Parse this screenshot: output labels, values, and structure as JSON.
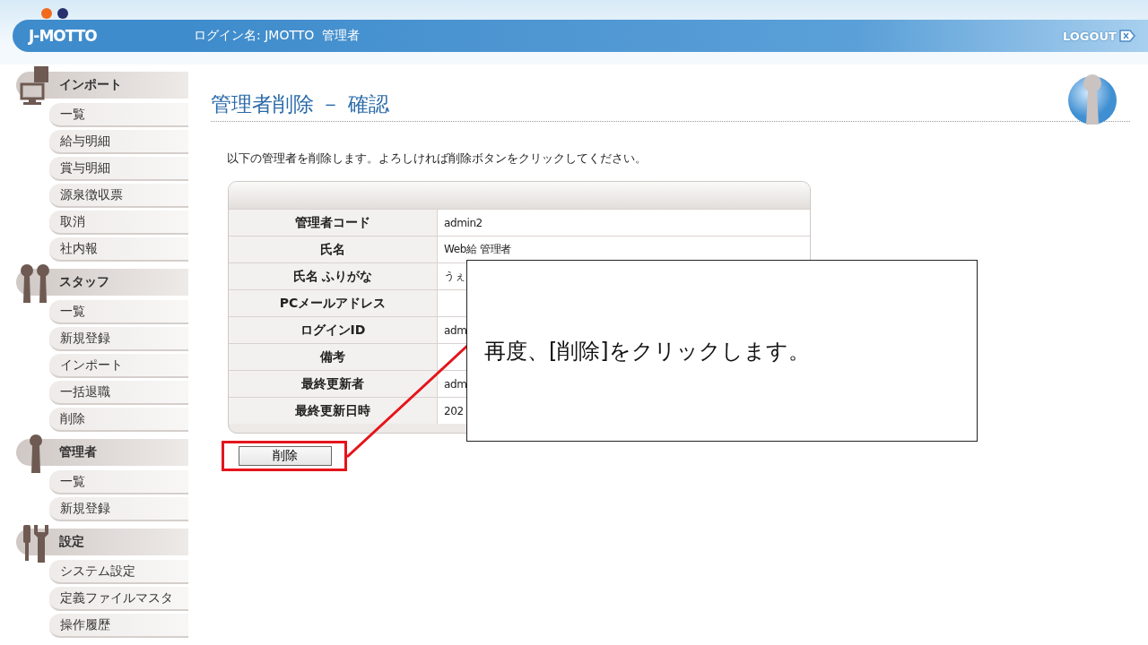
{
  "header": {
    "logo": "J-MOTTO",
    "login_label": "ログイン名: JMOTTO  管理者",
    "logout": "LOGOUT"
  },
  "sidebar": {
    "sections": [
      {
        "kind": "import",
        "title": "インポート",
        "items": [
          "一覧",
          "給与明細",
          "賞与明細",
          "源泉徴収票",
          "取消",
          "社内報"
        ]
      },
      {
        "kind": "staff",
        "title": "スタッフ",
        "items": [
          "一覧",
          "新規登録",
          "インポート",
          "一括退職",
          "削除"
        ]
      },
      {
        "kind": "admin",
        "title": "管理者",
        "items": [
          "一覧",
          "新規登録"
        ]
      },
      {
        "kind": "settings",
        "title": "設定",
        "items": [
          "システム設定",
          "定義ファイルマスタ",
          "操作履歴"
        ]
      }
    ]
  },
  "page": {
    "title": "管理者削除 － 確認",
    "instruction": "以下の管理者を削除します。よろしければ削除ボタンをクリックしてください。",
    "table": {
      "rows": [
        {
          "label": "管理者コード",
          "value": "admin2"
        },
        {
          "label": "氏名",
          "value": "Web給 管理者"
        },
        {
          "label": "氏名 ふりがな",
          "value": "うぇ"
        },
        {
          "label": "PCメールアドレス"
        },
        {
          "label": "ログインID",
          "value": "adm"
        },
        {
          "label": "備考"
        },
        {
          "label": "最終更新者",
          "value": "adm"
        },
        {
          "label": "最終更新日時",
          "value": "202"
        }
      ]
    },
    "delete_button": "削除"
  },
  "callout": {
    "text": "再度、[削除]をクリックします。"
  }
}
